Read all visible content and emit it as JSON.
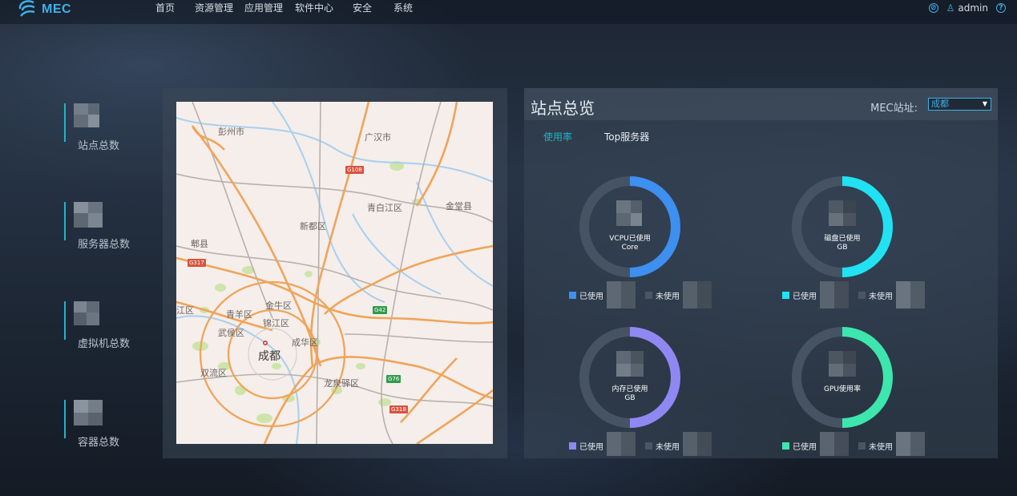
{
  "app": {
    "logo_text": "MEC"
  },
  "nav": [
    "首页",
    "资源管理",
    "应用管理",
    "软件中心",
    "安全",
    "系统"
  ],
  "topright": {
    "username": "admin"
  },
  "stats": [
    {
      "label": "站点总数"
    },
    {
      "label": "服务器总数"
    },
    {
      "label": "虚拟机总数"
    },
    {
      "label": "容器总数"
    }
  ],
  "map": {
    "labels": [
      "彭州市",
      "广汉市",
      "青白江区",
      "金堂县",
      "新都区",
      "郫县",
      "青羊区",
      "金牛区",
      "锦江区",
      "武侯区",
      "成华区",
      "成都",
      "双流区",
      "龙泉驿区",
      "江区"
    ],
    "road_badges": [
      "G108",
      "G317",
      "G42",
      "G76",
      "G318"
    ]
  },
  "overview": {
    "title": "站点总览",
    "site_label": "MEC站址:",
    "site_value": "成都",
    "tabs": [
      "使用率",
      "Top服务器"
    ],
    "gauges": [
      {
        "label_line1": "VCPU已使用",
        "label_line2": "Core",
        "used_fraction": 0.5,
        "color": "#3d8ff0"
      },
      {
        "label_line1": "磁盘已使用",
        "label_line2": "GB",
        "used_fraction": 0.5,
        "color": "#20e2f2"
      },
      {
        "label_line1": "内存已使用",
        "label_line2": "GB",
        "used_fraction": 0.5,
        "color": "#8f88f2"
      },
      {
        "label_line1": "GPU使用率",
        "label_line2": "",
        "used_fraction": 0.5,
        "color": "#3de6ad"
      }
    ],
    "legend_used": "已使用",
    "legend_unused": "未使用",
    "track_color": "#465362",
    "unused_swatch": "#4a5664"
  }
}
